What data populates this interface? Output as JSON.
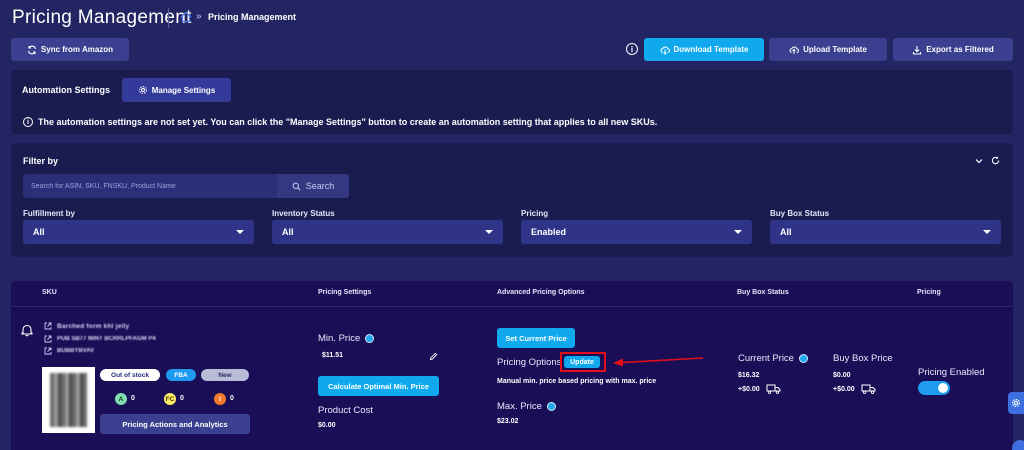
{
  "header": {
    "title": "Pricing Management",
    "breadcrumb": "Pricing Management",
    "breadcrumb_sep": "»"
  },
  "toolbar": {
    "sync": "Sync from Amazon",
    "download": "Download Template",
    "upload": "Upload Template",
    "export": "Export as Filtered",
    "info": "i"
  },
  "automation": {
    "title": "Automation Settings",
    "manage": "Manage Settings",
    "message": "The automation settings are not set yet. You can click the \"Manage Settings\" button to create an automation setting that applies to all new SKUs.",
    "info": "i"
  },
  "filter": {
    "title": "Filter by",
    "search_placeholder": "Search for ASIN, SKU, FNSKU, Product Name",
    "search_button": "Search",
    "fields": [
      {
        "label": "Fulfillment by",
        "value": "All"
      },
      {
        "label": "Inventory Status",
        "value": "All"
      },
      {
        "label": "Pricing",
        "value": "Enabled"
      },
      {
        "label": "Buy Box Status",
        "value": "All"
      }
    ]
  },
  "table": {
    "headers": [
      "SKU",
      "Pricing Settings",
      "Advanced Pricing Options",
      "Buy Box Status",
      "Pricing"
    ],
    "row": {
      "sku_lines": [
        "Barched form khl jelly",
        "PUB SB77 MINT BCRRLPFAGM P4",
        "BUBBYBVAV"
      ],
      "badges": {
        "stock": "Out of stock",
        "fba": "FBA",
        "condition": "New"
      },
      "counts": [
        {
          "letter": "A",
          "value": "0"
        },
        {
          "letter": "FC",
          "value": "0"
        },
        {
          "letter": "I",
          "value": "0"
        }
      ],
      "actions": "Pricing Actions and Analytics",
      "min_price_label": "Min. Price",
      "min_price": "$11.51",
      "calc_button": "Calculate Optimal Min. Price",
      "product_cost_label": "Product Cost",
      "product_cost": "$0.00",
      "set_current": "Set Current Price",
      "pricing_options_label": "Pricing Options",
      "update_badge": "Update",
      "pricing_desc": "Manual min. price based pricing with max. price",
      "max_price_label": "Max. Price",
      "max_price": "$23.02",
      "current_price_label": "Current Price",
      "current_price": "$16.32",
      "current_ship": "+$0.00",
      "buybox_price_label": "Buy Box Price",
      "buybox_price": "$0.00",
      "buybox_ship": "+$0.00",
      "pricing_enabled_label": "Pricing Enabled",
      "pricing_enabled": true
    }
  },
  "colors": {
    "background": "#232563",
    "panel": "#1a1c4f",
    "accent": "#11a9ee",
    "highlight": "#e0101a"
  }
}
